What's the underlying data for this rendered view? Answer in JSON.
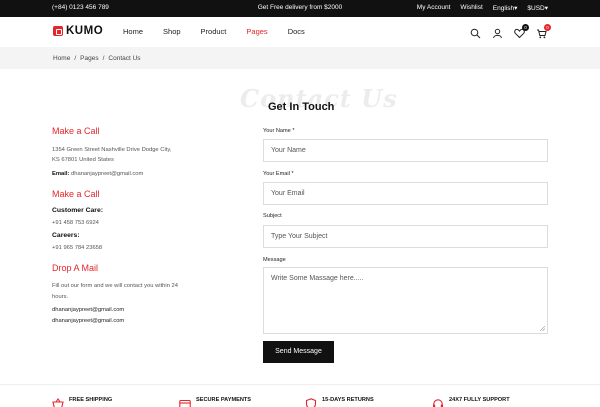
{
  "topbar": {
    "phone": "(+84) 0123 456 789",
    "promo": "Get Free delivery from $2000",
    "links": [
      "My Account",
      "Wishlist",
      "English",
      "$USD"
    ]
  },
  "brand": {
    "name": "KUMO",
    "accent": "#e4262c"
  },
  "nav": {
    "menu": [
      "Home",
      "Shop",
      "Product",
      "Pages",
      "Docs"
    ],
    "active": "Pages",
    "wishlist_count": "0",
    "cart_count": "0"
  },
  "breadcrumb": [
    "Home",
    "/",
    "Pages",
    "/",
    "Contact Us"
  ],
  "watermark": "Contact Us",
  "contact": {
    "call_heading": "Make a Call",
    "address_line1": "1354 Green Street Nashville Drive Dodge City,",
    "address_line2": "KS 67801 United States",
    "email_label": "Email:",
    "email_value": "dhananjaypreet@gmail.com",
    "call_heading2": "Make a Call",
    "care_label": "Customer Care:",
    "care_phone": "+91 458 753 6924",
    "careers_label": "Careers:",
    "careers_phone": "+91 965 784 23658",
    "mail_heading": "Drop A Mail",
    "mail_text1": "Fill out our form and we will contact you within 24",
    "mail_text2": "hours.",
    "mail1": "dhananjaypreet@gmail.com",
    "mail2": "dhananjaypreet@gmail.com"
  },
  "form": {
    "title": "Get In Touch",
    "name_label": "Your Name *",
    "name_placeholder": "Your Name",
    "email_label": "Your Email *",
    "email_placeholder": "Your Email",
    "subject_label": "Subject",
    "subject_placeholder": "Type Your Subject",
    "message_label": "Message",
    "message_placeholder": "Write Some Massage here.....",
    "submit": "Send Message"
  },
  "features": [
    "FREE SHIPPING",
    "SECURE PAYMENTS",
    "15-DAYS RETURNS",
    "24X7 FULLY SUPPORT"
  ]
}
